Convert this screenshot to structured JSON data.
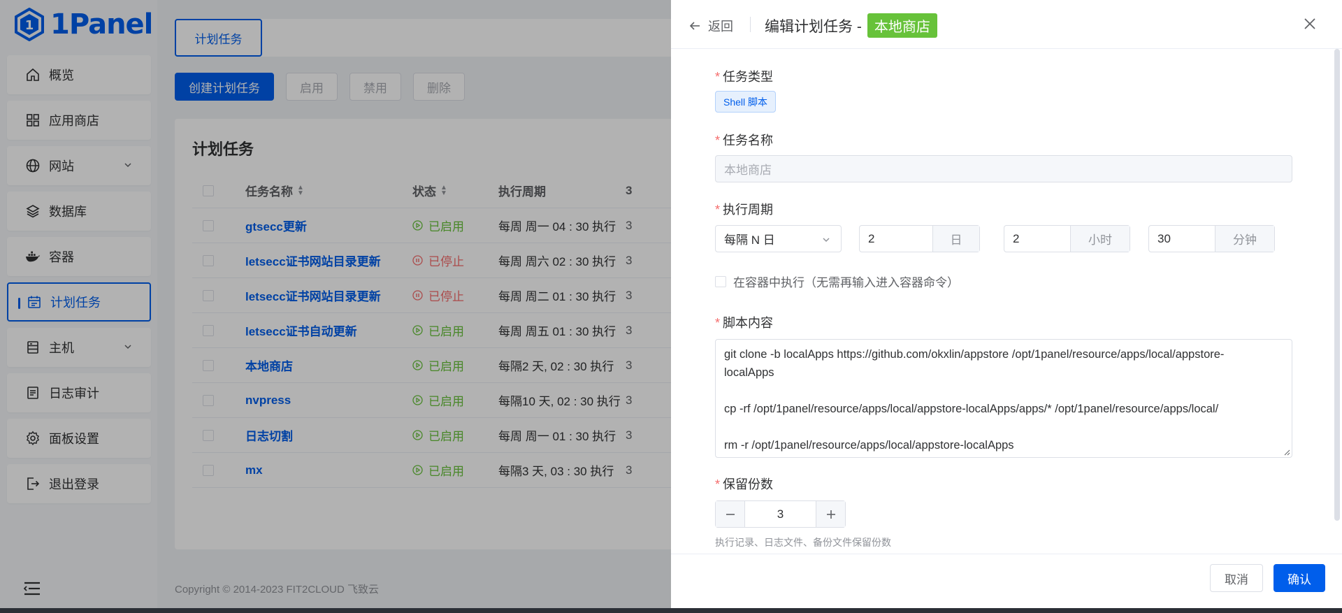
{
  "app": {
    "logo_text": "1Panel"
  },
  "sidebar": {
    "items": [
      {
        "label": "概览",
        "icon": "home-icon"
      },
      {
        "label": "应用商店",
        "icon": "apps-grid-icon"
      },
      {
        "label": "网站",
        "icon": "globe-icon",
        "expandable": true
      },
      {
        "label": "数据库",
        "icon": "database-layers-icon"
      },
      {
        "label": "容器",
        "icon": "docker-icon"
      },
      {
        "label": "计划任务",
        "icon": "calendar-icon",
        "active": true
      },
      {
        "label": "主机",
        "icon": "host-icon",
        "expandable": true
      },
      {
        "label": "日志审计",
        "icon": "log-icon"
      },
      {
        "label": "面板设置",
        "icon": "gear-icon"
      },
      {
        "label": "退出登录",
        "icon": "logout-icon"
      }
    ]
  },
  "topbar": {
    "tab_label": "计划任务"
  },
  "toolbar": {
    "create_label": "创建计划任务",
    "enable_label": "启用",
    "disable_label": "禁用",
    "delete_label": "删除"
  },
  "card": {
    "title": "计划任务",
    "columns": {
      "name": "任务名称",
      "status": "状态",
      "period": "执行周期",
      "next": "3"
    },
    "rows": [
      {
        "name": "gtsecc更新",
        "status": "已启用",
        "enabled": true,
        "period": "每周 周一 04 : 30 执行"
      },
      {
        "name": "letsecc证书网站目录更新",
        "status": "已停止",
        "enabled": false,
        "period": "每周 周六 02 : 30 执行"
      },
      {
        "name": "letsecc证书网站目录更新",
        "status": "已停止",
        "enabled": false,
        "period": "每周 周二 01 : 30 执行"
      },
      {
        "name": "letsecc证书自动更新",
        "status": "已启用",
        "enabled": true,
        "period": "每周 周五 01 : 30 执行"
      },
      {
        "name": "本地商店",
        "status": "已启用",
        "enabled": true,
        "period": "每隔2 天, 02 : 30 执行"
      },
      {
        "name": "nvpress",
        "status": "已启用",
        "enabled": true,
        "period": "每隔10 天, 02 : 30 执行"
      },
      {
        "name": "日志切割",
        "status": "已启用",
        "enabled": true,
        "period": "每周 周一 01 : 30 执行"
      },
      {
        "name": "mx",
        "status": "已启用",
        "enabled": true,
        "period": "每隔3 天, 03 : 30 执行"
      }
    ]
  },
  "footer": {
    "copyright": "Copyright © 2014-2023 FIT2CLOUD 飞致云"
  },
  "drawer": {
    "back_label": "返回",
    "title": "编辑计划任务 -",
    "title_tag": "本地商店",
    "fields": {
      "type_label": "任务类型",
      "type_value": "Shell 脚本",
      "name_label": "任务名称",
      "name_placeholder": "本地商店",
      "period_label": "执行周期",
      "period_select": "每隔 N 日",
      "day_value": "2",
      "day_unit": "日",
      "hour_value": "2",
      "hour_unit": "小时",
      "minute_value": "30",
      "minute_unit": "分钟",
      "container_label": "在容器中执行（无需再输入进入容器命令）",
      "script_label": "脚本内容",
      "script_lines": [
        "git clone -b localApps https://github.com/okxlin/appstore /opt/1panel/resource/apps/local/appstore-",
        "localApps",
        "",
        "cp -rf /opt/1panel/resource/apps/local/appstore-localApps/apps/* /opt/1panel/resource/apps/local/",
        "",
        "rm -r /opt/1panel/resource/apps/local/appstore-localApps"
      ],
      "retain_label": "保留份数",
      "retain_value": "3",
      "retain_hint": "执行记录、日志文件、备份文件保留份数"
    },
    "cancel_label": "取消",
    "confirm_label": "确认"
  }
}
